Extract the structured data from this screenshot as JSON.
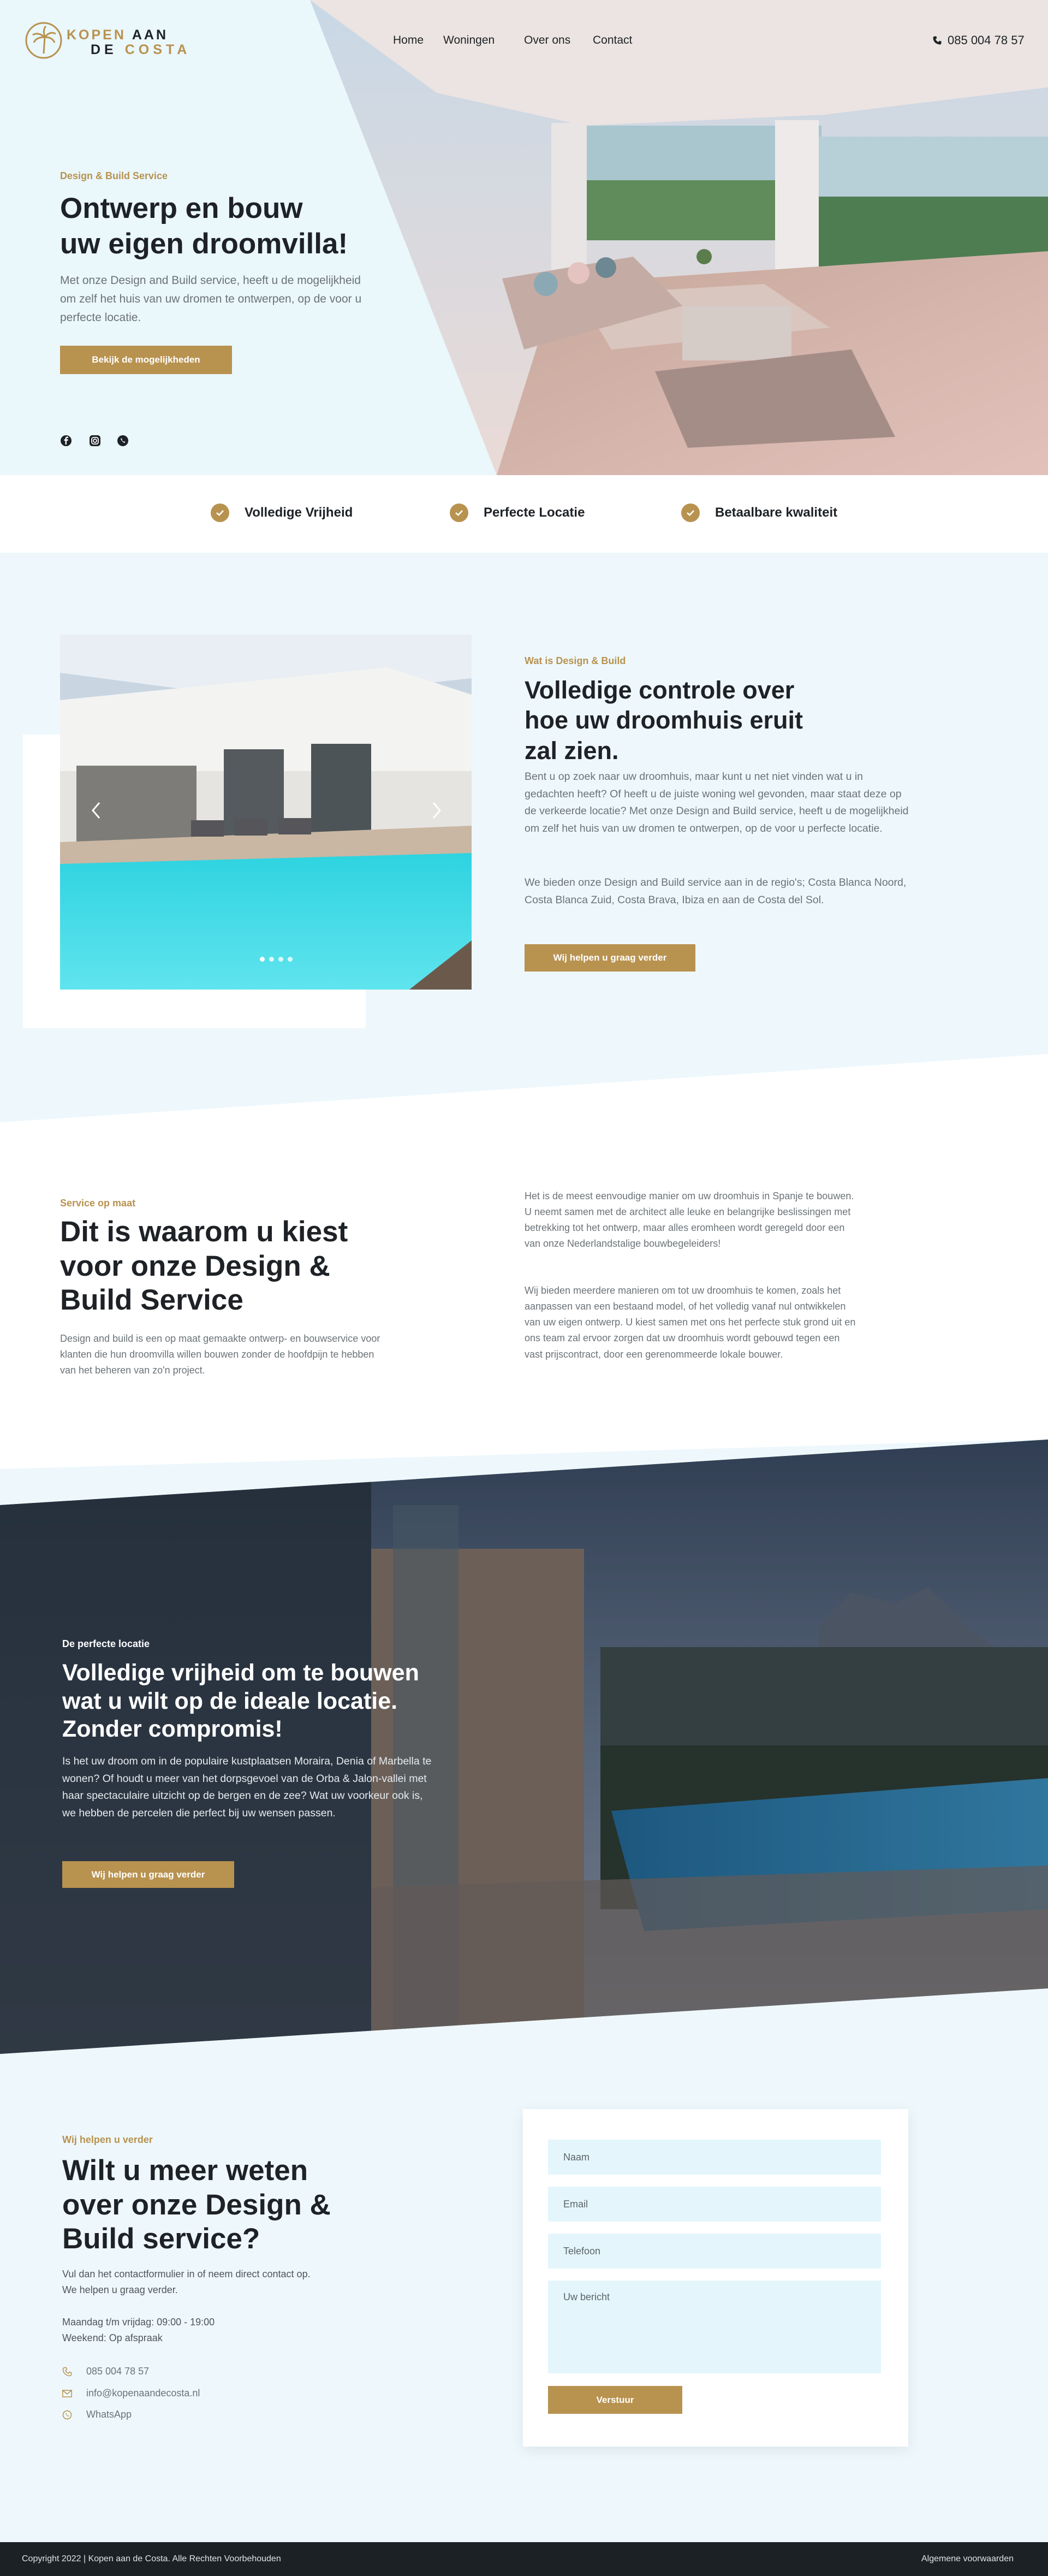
{
  "brand": {
    "line1_gold": "KOPEN",
    "line1_dark": "AAN",
    "line2_dark": "DE",
    "line2_gold": "COSTA"
  },
  "nav": {
    "home": "Home",
    "woningen": "Woningen",
    "over_ons": "Over ons",
    "contact": "Contact",
    "phone": "085 004 78 57"
  },
  "hero": {
    "eyebrow": "Design & Build Service",
    "title_line1": "Ontwerp en bouw",
    "title_line2": "uw eigen droomvilla!",
    "text": "Met onze Design and Build service, heeft u de mogelijkheid om zelf het huis van uw dromen te ontwerpen, op de voor u perfecte locatie.",
    "cta": "Bekijk de mogelijkheden"
  },
  "features": [
    "Volledige Vrijheid",
    "Perfecte Locatie",
    "Betaalbare kwaliteit"
  ],
  "about": {
    "eyebrow": "Wat is Design & Build",
    "title_line1": "Volledige controle over",
    "title_line2": "hoe uw droomhuis eruit",
    "title_line3": "zal zien.",
    "p1": "Bent u op zoek naar uw droomhuis, maar kunt u net niet vinden wat u in gedachten heeft? Of heeft u de juiste woning wel gevonden, maar staat deze op de verkeerde locatie? Met onze Design and Build service, heeft u de mogelijkheid om zelf het huis van uw dromen te ontwerpen, op de voor u perfecte locatie.",
    "p2": "We bieden onze Design and Build service aan in de regio's; Costa Blanca Noord, Costa Blanca Zuid, Costa Brava, Ibiza en aan de Costa del Sol.",
    "cta": "Wij helpen u graag verder"
  },
  "why": {
    "eyebrow": "Service op maat",
    "title_line1": "Dit is waarom u kiest",
    "title_line2": "voor onze Design &",
    "title_line3": "Build Service",
    "intro": "Design and build is een op maat gemaakte ontwerp- en bouwservice voor klanten die hun droomvilla willen bouwen zonder de hoofdpijn te hebben van het beheren van zo'n project.",
    "p1": "Het is de meest eenvoudige manier om uw droomhuis in Spanje te bouwen. U neemt samen met de architect alle leuke en belangrijke beslissingen met betrekking tot het ontwerp, maar alles eromheen wordt geregeld door een van onze Nederlandstalige bouwbegeleiders!",
    "p2": "Wij bieden meerdere manieren om tot uw droomhuis te komen, zoals het aanpassen van een bestaand model, of het volledig vanaf nul ontwikkelen van uw eigen ontwerp. U kiest samen met ons het perfecte stuk grond uit en ons team zal ervoor zorgen dat uw droomhuis wordt gebouwd tegen een vast prijscontract, door een gerenommeerde lokale bouwer."
  },
  "location": {
    "eyebrow": "De perfecte locatie",
    "title_line1": "Volledige vrijheid om te bouwen",
    "title_line2": "wat u wilt op de ideale locatie.",
    "title_line3": "Zonder compromis!",
    "text": "Is het uw droom om in de populaire kustplaatsen Moraira, Denia of Marbella te wonen? Of houdt u meer van het dorpsgevoel van de Orba & Jalon-vallei met haar spectaculaire uitzicht op de bergen en de zee? Wat uw voorkeur ook is, we hebben de percelen die perfect bij uw wensen passen.",
    "cta": "Wij helpen u graag verder"
  },
  "contact": {
    "eyebrow": "Wij helpen u verder",
    "title_line1": "Wilt u meer weten",
    "title_line2": "over onze Design &",
    "title_line3": "Build service?",
    "text_line1": "Vul dan het contactformulier in of neem direct contact op.",
    "text_line2": "We helpen u graag verder.",
    "hours_line1": "Maandag t/m vrijdag: 09:00 - 19:00",
    "hours_line2": "Weekend: Op afspraak",
    "phone": "085 004 78 57",
    "email": "info@kopenaandecosta.nl",
    "whatsapp": "WhatsApp"
  },
  "form": {
    "name_placeholder": "Naam",
    "email_placeholder": "Email",
    "phone_placeholder": "Telefoon",
    "message_placeholder": "Uw bericht",
    "submit": "Verstuur"
  },
  "footer": {
    "copyright": "Copyright 2022 | Kopen aan de Costa. Alle Rechten Voorbehouden",
    "terms": "Algemene voorwaarden"
  },
  "colors": {
    "accent": "#b8924f",
    "dark": "#1e2226",
    "light_bg": "#eef8fc",
    "footer": "#1c2125"
  }
}
